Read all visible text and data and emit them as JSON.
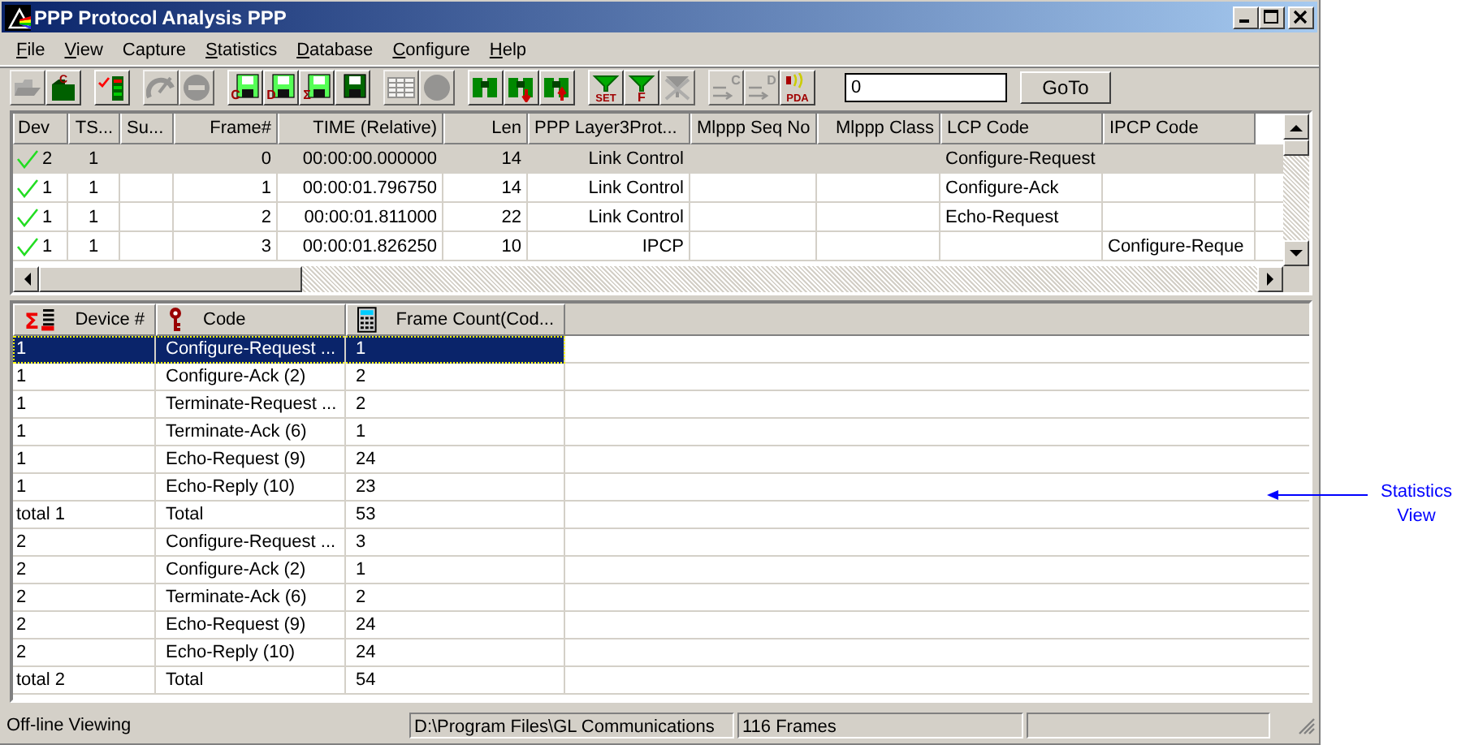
{
  "window": {
    "title": "PPP Protocol Analysis PPP"
  },
  "menu": [
    {
      "key": "F",
      "rest": "ile"
    },
    {
      "key": "V",
      "rest": "iew"
    },
    {
      "label": "Capture"
    },
    {
      "key": "S",
      "rest": "tatistics"
    },
    {
      "key": "D",
      "rest": "atabase"
    },
    {
      "key": "C",
      "rest": "onfigure"
    },
    {
      "key": "H",
      "rest": "elp"
    }
  ],
  "toolbar": [
    {
      "buttons": [
        {
          "kind": "folder-open",
          "disabled": true
        },
        {
          "kind": "folder",
          "letter": "C",
          "disabled": false
        }
      ]
    },
    {
      "buttons": [
        {
          "kind": "checklist",
          "disabled": false
        }
      ]
    },
    {
      "buttons": [
        {
          "kind": "gauge",
          "disabled": true
        },
        {
          "kind": "stop",
          "disabled": true
        }
      ]
    },
    {
      "buttons": [
        {
          "kind": "disk",
          "letter": "C",
          "disabled": false
        },
        {
          "kind": "disk",
          "letter": "D",
          "disabled": false
        },
        {
          "kind": "disk",
          "letter": "Σ",
          "disabled": false
        },
        {
          "kind": "disk",
          "disabled": false
        }
      ]
    },
    {
      "buttons": [
        {
          "kind": "grid",
          "disabled": true
        },
        {
          "kind": "circle",
          "disabled": true
        }
      ]
    },
    {
      "buttons": [
        {
          "kind": "binoculars",
          "disabled": false
        },
        {
          "kind": "binoculars-down",
          "disabled": false
        },
        {
          "kind": "binoculars-up",
          "disabled": false
        }
      ]
    },
    {
      "buttons": [
        {
          "kind": "filter",
          "letter": "SET",
          "disabled": false
        },
        {
          "kind": "filter",
          "letter": "F",
          "disabled": false
        },
        {
          "kind": "filter-x",
          "disabled": true
        }
      ]
    },
    {
      "buttons": [
        {
          "kind": "arrows",
          "letter": "C",
          "disabled": true
        },
        {
          "kind": "arrows",
          "letter": "D",
          "disabled": true
        },
        {
          "kind": "speaker",
          "letter": "PDA",
          "disabled": false
        }
      ]
    }
  ],
  "goto": {
    "value": "0",
    "button": "GoTo"
  },
  "frames_table": {
    "columns": [
      "Dev",
      "TS...",
      "Su...",
      "Frame#",
      "TIME (Relative)",
      "Len",
      "PPP Layer3Prot...",
      "Mlppp Seq No",
      "Mlppp Class",
      "LCP Code",
      "IPCP Code"
    ],
    "rows": [
      {
        "selected": true,
        "cells": [
          "2",
          "1",
          "",
          "0",
          "00:00:00.000000",
          "14",
          "Link Control",
          "",
          "",
          "Configure-Request",
          ""
        ]
      },
      {
        "selected": false,
        "cells": [
          "1",
          "1",
          "",
          "1",
          "00:00:01.796750",
          "14",
          "Link Control",
          "",
          "",
          "Configure-Ack",
          ""
        ]
      },
      {
        "selected": false,
        "cells": [
          "1",
          "1",
          "",
          "2",
          "00:00:01.811000",
          "22",
          "Link Control",
          "",
          "",
          "Echo-Request",
          ""
        ]
      },
      {
        "selected": false,
        "cells": [
          "1",
          "1",
          "",
          "3",
          "00:00:01.826250",
          "10",
          "IPCP",
          "",
          "",
          "",
          "Configure-Reque"
        ]
      }
    ]
  },
  "statistics_table": {
    "columns": [
      {
        "kind": "sigma",
        "letter": "Σ",
        "label": "Device #"
      },
      {
        "kind": "key",
        "label": "Code"
      },
      {
        "kind": "calculator",
        "label": "Frame Count(Cod..."
      }
    ],
    "rows": [
      {
        "selected": true,
        "cells": [
          "1",
          "Configure-Request ...",
          "1"
        ]
      },
      {
        "selected": false,
        "cells": [
          "1",
          "Configure-Ack (2)",
          "2"
        ]
      },
      {
        "selected": false,
        "cells": [
          "1",
          "Terminate-Request ...",
          "2"
        ]
      },
      {
        "selected": false,
        "cells": [
          "1",
          "Terminate-Ack (6)",
          "1"
        ]
      },
      {
        "selected": false,
        "cells": [
          "1",
          "Echo-Request (9)",
          "24"
        ]
      },
      {
        "selected": false,
        "cells": [
          "1",
          "Echo-Reply (10)",
          "23"
        ]
      },
      {
        "selected": false,
        "cells": [
          "total 1",
          "Total",
          "53"
        ]
      },
      {
        "selected": false,
        "cells": [
          "2",
          "Configure-Request ...",
          "3"
        ]
      },
      {
        "selected": false,
        "cells": [
          "2",
          "Configure-Ack (2)",
          "1"
        ]
      },
      {
        "selected": false,
        "cells": [
          "2",
          "Terminate-Ack (6)",
          "2"
        ]
      },
      {
        "selected": false,
        "cells": [
          "2",
          "Echo-Request (9)",
          "24"
        ]
      },
      {
        "selected": false,
        "cells": [
          "2",
          "Echo-Reply (10)",
          "24"
        ]
      },
      {
        "selected": false,
        "cells": [
          "total 2",
          "Total",
          "54"
        ]
      }
    ]
  },
  "status_bar": [
    "Off-line Viewing",
    "D:\\Program Files\\GL Communications",
    "116 Frames"
  ],
  "annotation": "Statistics View"
}
